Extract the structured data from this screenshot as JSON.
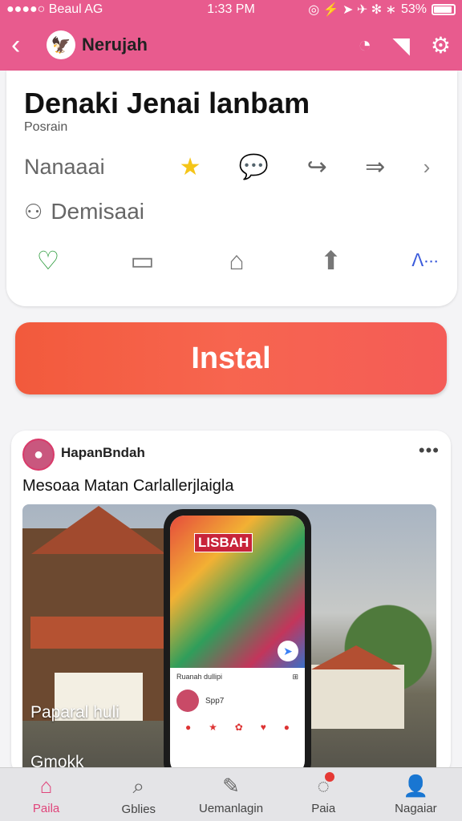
{
  "status_bar": {
    "carrier": "●●●●○ Beaul AG",
    "time": "1:33 PM",
    "right_icons": "◎ ⚡ ➤ ✈ ✻ ∗",
    "battery": "53%"
  },
  "nav": {
    "back_icon": "‹",
    "logo_glyph": "🦅",
    "title": "Nerujah",
    "actions": [
      "◔",
      "◥",
      "⚙"
    ]
  },
  "app_info": {
    "title": "Denaki Jenai lanbam",
    "subtitle": "Posrain",
    "meta_label": "Nanaaai",
    "meta_icons": [
      "★",
      "💬",
      "↪",
      "⇒",
      "›"
    ],
    "row2_icon": "⚇",
    "row2_label": "Demisaai",
    "icon_row": [
      "♡",
      "▭",
      "⌂",
      "⬆",
      "ᐱ∙∙∙"
    ]
  },
  "install": {
    "label": "Instal"
  },
  "post": {
    "avatar_glyph": "●",
    "author": "HapanBndah",
    "more": "•••",
    "text": "Mesoaa Matan Carlallerjlaigla",
    "image_caption": "Paparal huli",
    "image_caption2": "Gmokk",
    "phone": {
      "art_title": "LISBAH",
      "art_badge": "➤",
      "list_head_left": "Ruanah dullipi",
      "list_head_right": "⊞",
      "list_row_text": "Spp7",
      "list_icons": [
        "●",
        "★",
        "✿",
        "♥",
        "●"
      ]
    }
  },
  "tabs": [
    {
      "icon": "⌂",
      "label": "Paila",
      "active": true
    },
    {
      "icon": "⌕",
      "label": "Gblies",
      "active": false
    },
    {
      "icon": "✎",
      "label": "Uemanlagin",
      "active": false
    },
    {
      "icon": "◌",
      "label": "Paia",
      "active": false
    },
    {
      "icon": "👤",
      "label": "Nagaiar",
      "active": false
    }
  ],
  "colors": {
    "brand": "#e85b8e",
    "install": "#f25a3c",
    "active_tab": "#e0457b"
  }
}
